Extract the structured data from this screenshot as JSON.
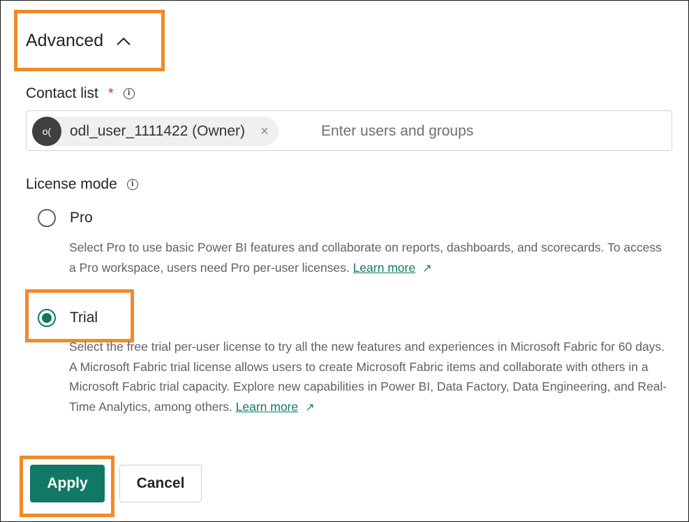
{
  "advanced": {
    "title": "Advanced"
  },
  "contact_list": {
    "label": "Contact list",
    "required_mark": "*",
    "chip": {
      "avatar_initials": "o(",
      "text": "odl_user_1111422 (Owner)",
      "remove": "×"
    },
    "placeholder": "Enter users and groups"
  },
  "license_mode": {
    "label": "License mode",
    "options": [
      {
        "label": "Pro",
        "checked": false,
        "description": "Select Pro to use basic Power BI features and collaborate on reports, dashboards, and scorecards. To access a Pro workspace, users need Pro per-user licenses.",
        "learn_more": "Learn more"
      },
      {
        "label": "Trial",
        "checked": true,
        "description": "Select the free trial per-user license to try all the new features and experiences in Microsoft Fabric for 60 days. A Microsoft Fabric trial license allows users to create Microsoft Fabric items and collaborate with others in a Microsoft Fabric trial capacity. Explore new capabilities in Power BI, Data Factory, Data Engineering, and Real-Time Analytics, among others.",
        "learn_more": "Learn more"
      }
    ]
  },
  "buttons": {
    "apply": "Apply",
    "cancel": "Cancel"
  },
  "colors": {
    "accent": "#117865",
    "highlight": "#f08a2b"
  }
}
